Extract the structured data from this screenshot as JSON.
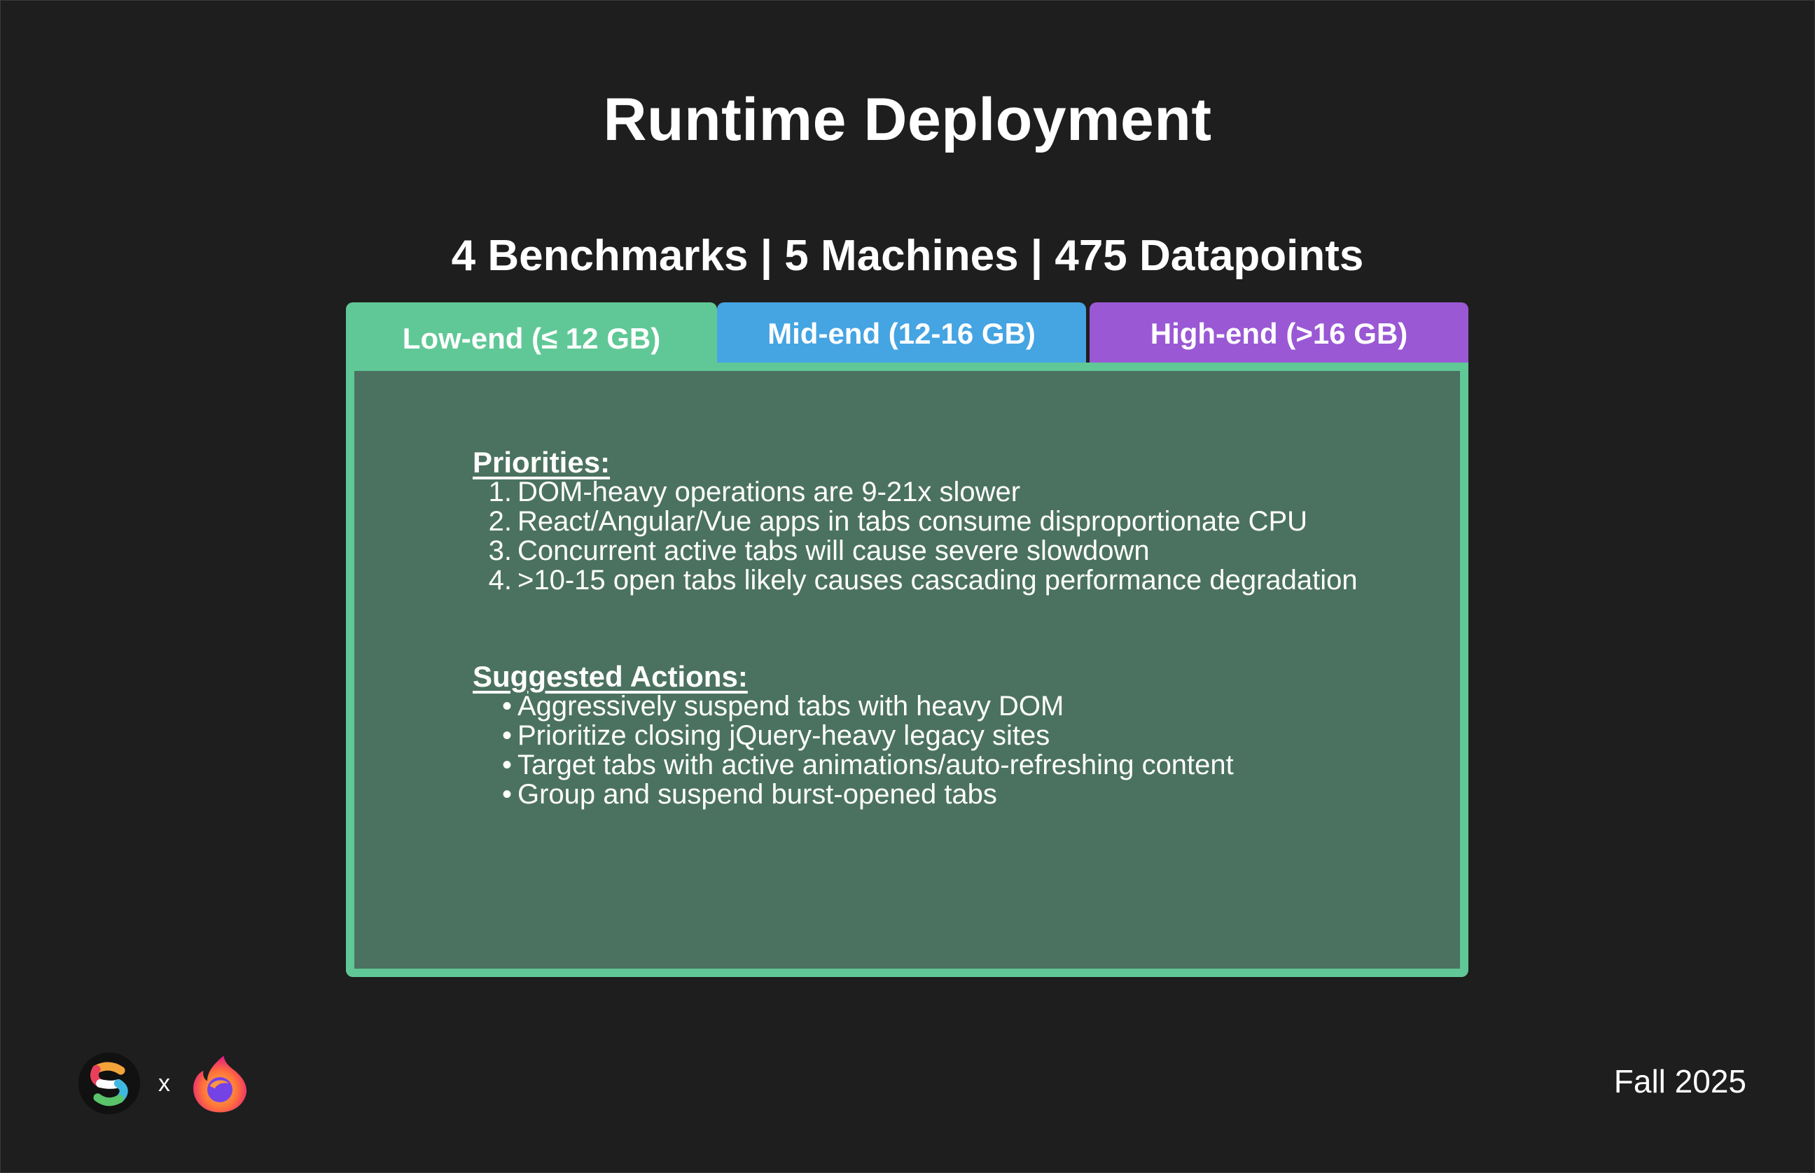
{
  "slide": {
    "title": "Runtime Deployment",
    "subtitle": "4 Benchmarks | 5 Machines | 475 Datapoints"
  },
  "tabs": [
    {
      "label": "Low-end (≤ 12 GB)",
      "color": "#60c896",
      "active": true
    },
    {
      "label": "Mid-end (12-16 GB)",
      "color": "#45a4e2",
      "active": false
    },
    {
      "label": "High-end (>16 GB)",
      "color": "#9a58d4",
      "active": false
    }
  ],
  "panel": {
    "background": "#4b7260",
    "border_color": "#60c896",
    "priorities": {
      "heading": "Priorities:",
      "items": [
        {
          "marker": "1.",
          "text": "DOM-heavy operations are 9-21x slower"
        },
        {
          "marker": "2.",
          "text": "React/Angular/Vue apps in tabs consume disproportionate CPU"
        },
        {
          "marker": "3.",
          "text": "Concurrent active tabs will cause severe slowdown"
        },
        {
          "marker": "4.",
          "text": ">10-15 open tabs likely causes cascading performance degradation"
        }
      ]
    },
    "actions": {
      "heading": "Suggested Actions:",
      "items": [
        {
          "marker": "•",
          "text": "Aggressively suspend tabs with heavy DOM"
        },
        {
          "marker": "•",
          "text": "Prioritize closing jQuery-heavy legacy sites"
        },
        {
          "marker": "•",
          "text": "Target tabs with active animations/auto-refreshing content"
        },
        {
          "marker": "•",
          "text": "Group and suspend burst-opened tabs"
        }
      ]
    }
  },
  "footer": {
    "left_logo_icon": "colorful-s-logo-icon",
    "separator": "x",
    "right_logo_icon": "firefox-logo-icon",
    "date": "Fall 2025"
  }
}
